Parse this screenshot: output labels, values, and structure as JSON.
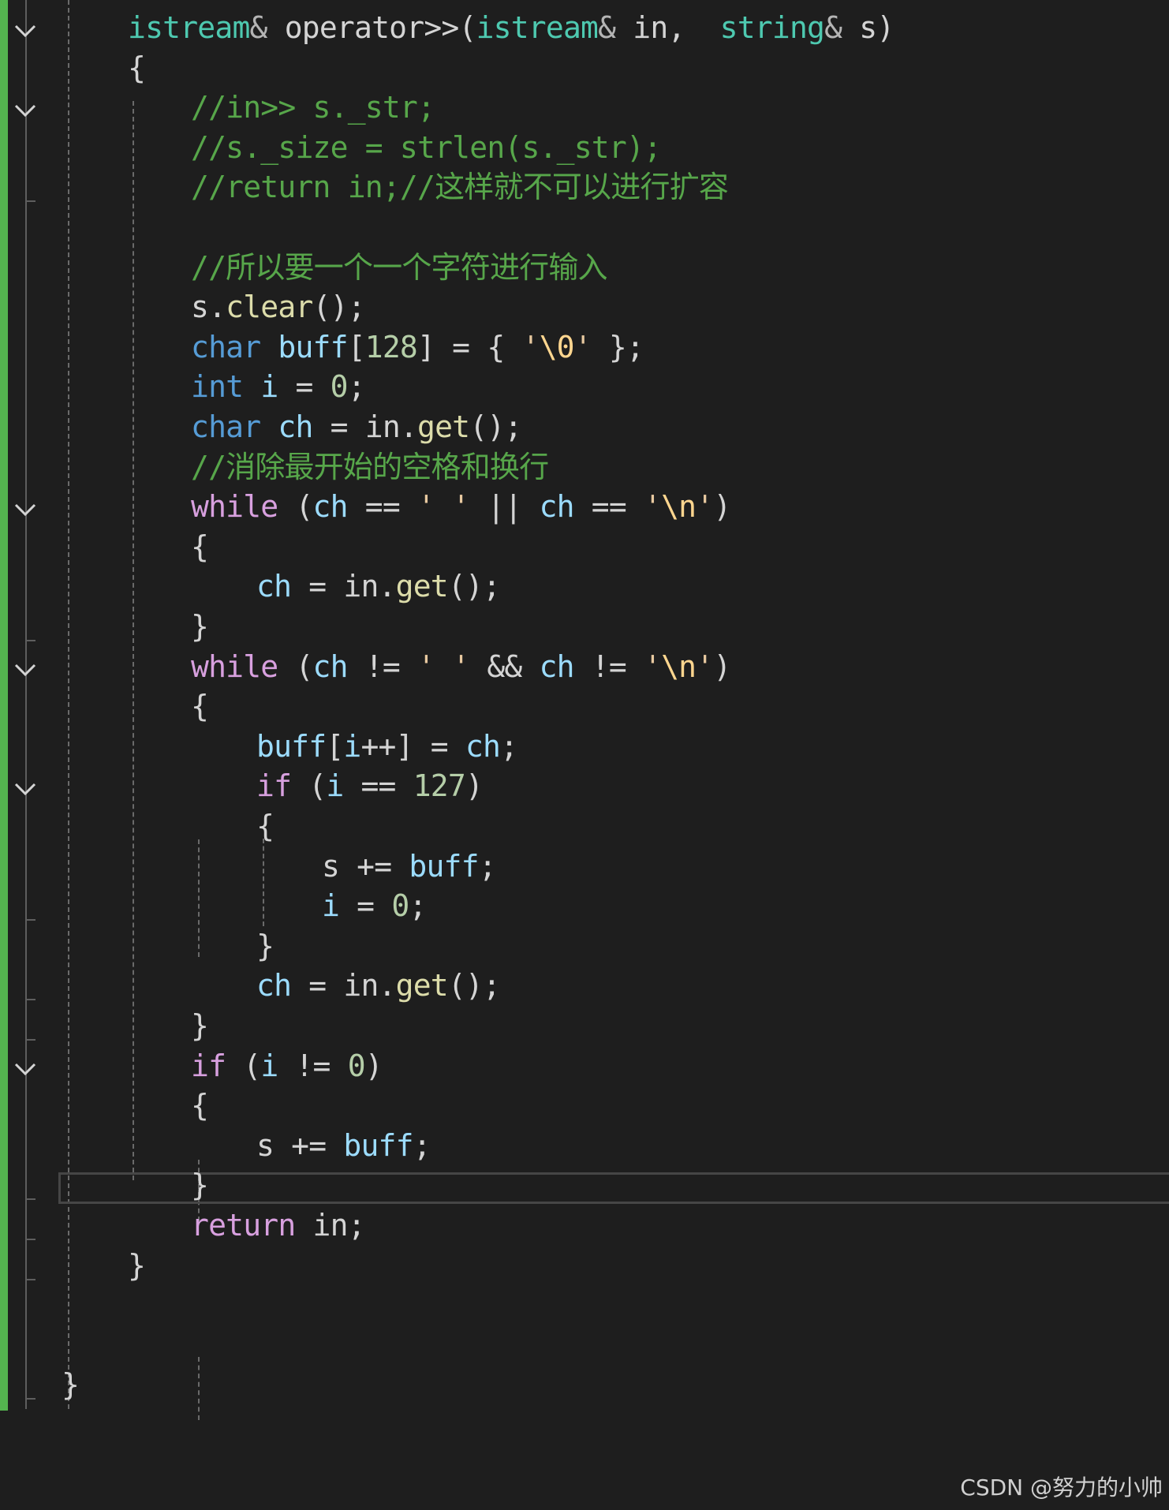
{
  "watermark": "CSDN @努力的小帅",
  "colors": {
    "background": "#1e1e1e",
    "change_bar": "#54b34f",
    "keyword": "#569cd6",
    "control_keyword": "#d8a0df",
    "type": "#4ec9b0",
    "variable": "#9cdcfe",
    "function": "#dcdcaa",
    "string": "#e8c9a0",
    "number": "#b5cea8",
    "comment": "#57a64a"
  },
  "icons": {
    "fold": "chevron-down-icon"
  },
  "code": {
    "lines": [
      [
        [
          "type",
          "istream"
        ],
        [
          "op",
          "&"
        ],
        [
          "pun",
          " operator>>("
        ],
        [
          "type",
          "istream"
        ],
        [
          "op",
          "&"
        ],
        [
          "pun",
          " in,  "
        ],
        [
          "type",
          "string"
        ],
        [
          "op",
          "&"
        ],
        [
          "pun",
          " s)"
        ]
      ],
      [
        [
          "pun",
          "{"
        ]
      ],
      [
        [
          "cmt",
          "//in>> s._str;"
        ]
      ],
      [
        [
          "cmt",
          "//s._size = strlen(s._str);"
        ]
      ],
      [
        [
          "cmt",
          "//return in;//这样就不可以进行扩容"
        ]
      ],
      [],
      [
        [
          "cmt",
          "//所以要一个一个字符进行输入"
        ]
      ],
      [
        [
          "pun",
          "s."
        ],
        [
          "fn",
          "clear"
        ],
        [
          "pun",
          "();"
        ]
      ],
      [
        [
          "kw",
          "char"
        ],
        [
          "pun",
          " "
        ],
        [
          "var",
          "buff"
        ],
        [
          "pun",
          "["
        ],
        [
          "num",
          "128"
        ],
        [
          "pun",
          "] = { "
        ],
        [
          "str",
          "'"
        ],
        [
          "esc",
          "\\0"
        ],
        [
          "str",
          "'"
        ],
        [
          "pun",
          " };"
        ]
      ],
      [
        [
          "kw",
          "int"
        ],
        [
          "pun",
          " "
        ],
        [
          "var",
          "i"
        ],
        [
          "pun",
          " = "
        ],
        [
          "num",
          "0"
        ],
        [
          "pun",
          ";"
        ]
      ],
      [
        [
          "kw",
          "char"
        ],
        [
          "pun",
          " "
        ],
        [
          "var",
          "ch"
        ],
        [
          "pun",
          " = in."
        ],
        [
          "fn",
          "get"
        ],
        [
          "pun",
          "();"
        ]
      ],
      [
        [
          "cmt",
          "//消除最开始的空格和换行"
        ]
      ],
      [
        [
          "ctl",
          "while"
        ],
        [
          "pun",
          " ("
        ],
        [
          "var",
          "ch"
        ],
        [
          "pun",
          " == "
        ],
        [
          "str",
          "' '"
        ],
        [
          "pun",
          " || "
        ],
        [
          "var",
          "ch"
        ],
        [
          "pun",
          " == "
        ],
        [
          "str",
          "'"
        ],
        [
          "esc",
          "\\n"
        ],
        [
          "str",
          "'"
        ],
        [
          "pun",
          ")"
        ]
      ],
      [
        [
          "pun",
          "{"
        ]
      ],
      [
        [
          "var",
          "ch"
        ],
        [
          "pun",
          " = in."
        ],
        [
          "fn",
          "get"
        ],
        [
          "pun",
          "();"
        ]
      ],
      [
        [
          "pun",
          "}"
        ]
      ],
      [
        [
          "ctl",
          "while"
        ],
        [
          "pun",
          " ("
        ],
        [
          "var",
          "ch"
        ],
        [
          "pun",
          " != "
        ],
        [
          "str",
          "' '"
        ],
        [
          "pun",
          " && "
        ],
        [
          "var",
          "ch"
        ],
        [
          "pun",
          " != "
        ],
        [
          "str",
          "'"
        ],
        [
          "esc",
          "\\n"
        ],
        [
          "str",
          "'"
        ],
        [
          "pun",
          ")"
        ]
      ],
      [
        [
          "pun",
          "{"
        ]
      ],
      [
        [
          "var",
          "buff"
        ],
        [
          "pun",
          "["
        ],
        [
          "var",
          "i"
        ],
        [
          "pun",
          "++] = "
        ],
        [
          "var",
          "ch"
        ],
        [
          "pun",
          ";"
        ]
      ],
      [
        [
          "ctl",
          "if"
        ],
        [
          "pun",
          " ("
        ],
        [
          "var",
          "i"
        ],
        [
          "pun",
          " == "
        ],
        [
          "num",
          "127"
        ],
        [
          "pun",
          ")"
        ]
      ],
      [
        [
          "pun",
          "{"
        ]
      ],
      [
        [
          "pun",
          "s += "
        ],
        [
          "var",
          "buff"
        ],
        [
          "pun",
          ";"
        ]
      ],
      [
        [
          "var",
          "i"
        ],
        [
          "pun",
          " = "
        ],
        [
          "num",
          "0"
        ],
        [
          "pun",
          ";"
        ]
      ],
      [
        [
          "pun",
          "}"
        ]
      ],
      [
        [
          "var",
          "ch"
        ],
        [
          "pun",
          " = in."
        ],
        [
          "fn",
          "get"
        ],
        [
          "pun",
          "();"
        ]
      ],
      [
        [
          "pun",
          "}"
        ]
      ],
      [
        [
          "ctl",
          "if"
        ],
        [
          "pun",
          " ("
        ],
        [
          "var",
          "i"
        ],
        [
          "pun",
          " != "
        ],
        [
          "num",
          "0"
        ],
        [
          "pun",
          ")"
        ]
      ],
      [
        [
          "pun",
          "{"
        ]
      ],
      [
        [
          "pun",
          "s += "
        ],
        [
          "var",
          "buff"
        ],
        [
          "pun",
          ";"
        ]
      ],
      [
        [
          "pun",
          "}"
        ]
      ],
      [
        [
          "ctl",
          "return"
        ],
        [
          "pun",
          " in;"
        ]
      ],
      [
        [
          "pun",
          "}"
        ]
      ],
      [],
      [],
      [
        [
          "pun",
          "}"
        ]
      ]
    ]
  }
}
